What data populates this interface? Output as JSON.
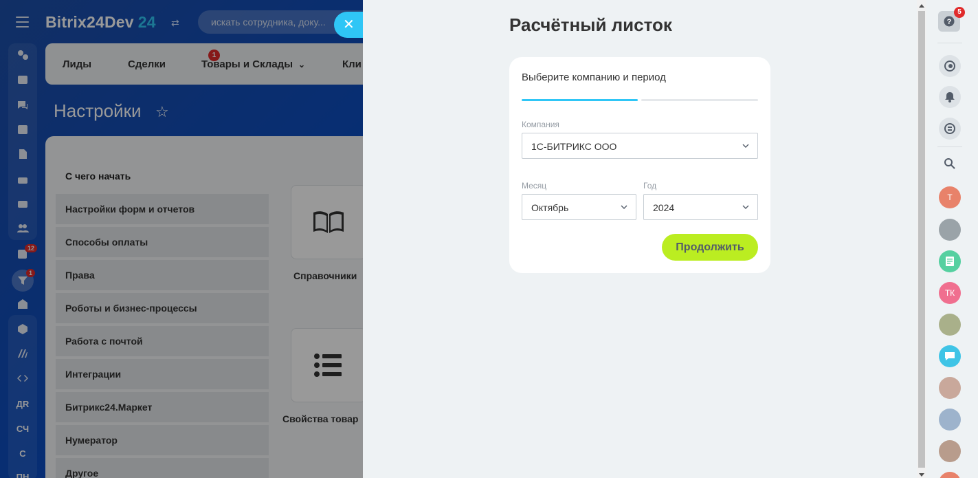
{
  "app": {
    "brand_name": "Bitrix24Dev",
    "brand_number": "24",
    "search_placeholder": "искать сотрудника, доку..."
  },
  "left_rail": {
    "badges": {
      "tasks": "12",
      "crm": "1"
    },
    "text_items": [
      "ДR",
      "СЧ",
      "С",
      "ПН"
    ]
  },
  "menu": {
    "items": [
      "Лиды",
      "Сделки",
      "Товары и Склады",
      "Кли"
    ],
    "deals_badge": "1"
  },
  "background_page": {
    "title": "Настройки",
    "section_title": "С чего начать",
    "settings_items": [
      "Настройки форм и отчетов",
      "Способы оплаты",
      "Права",
      "Роботы и бизнес-процессы",
      "Работа с почтой",
      "Интеграции",
      "Битрикс24.Маркет",
      "Нумератор",
      "Другое"
    ],
    "tiles": [
      "Справочники",
      "Свойства товар"
    ]
  },
  "slider": {
    "title": "Расчётный листок",
    "step_title": "Выберите компанию и период",
    "progress": {
      "current_step": 1,
      "total_steps": 2
    },
    "company": {
      "label": "Компания",
      "value": "1С-БИТРИКС ООО"
    },
    "month": {
      "label": "Месяц",
      "value": "Октябрь"
    },
    "year": {
      "label": "Год",
      "value": "2024"
    },
    "continue_label": "Продолжить"
  },
  "right_rail": {
    "help_badge": "5",
    "avatars": [
      {
        "initials": "T",
        "color": "#e8826a"
      },
      {
        "initials": "",
        "color": "#9aa3a8"
      },
      {
        "initials": "",
        "color": "#55d0a0"
      },
      {
        "initials": "ТК",
        "color": "#f06f8f"
      },
      {
        "initials": "",
        "color": "#a9b08a"
      },
      {
        "initials": "",
        "color": "#3fc4e6"
      },
      {
        "initials": "",
        "color": "#c9a89b"
      },
      {
        "initials": "",
        "color": "#9db3cc"
      },
      {
        "initials": "",
        "color": "#b89c8c"
      }
    ]
  },
  "colors": {
    "accent": "#2fc6f6",
    "primary_button": "#bbed21",
    "badge": "#e02b2b"
  }
}
